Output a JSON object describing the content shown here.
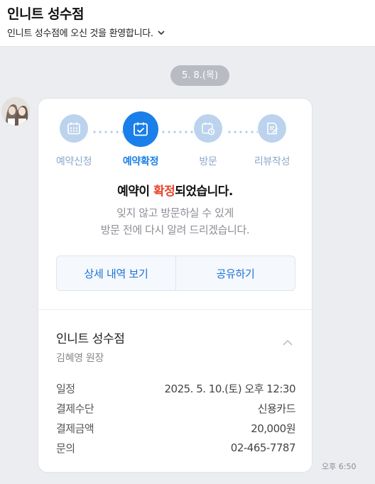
{
  "header": {
    "title": "인니트 성수점",
    "subtitle": "인니트 성수점에 오신 것을 환영합니다."
  },
  "date_pill": "5. 8.(목)",
  "card": {
    "steps": [
      {
        "label": "예약신청",
        "icon": "calendar-grid-icon",
        "active": false
      },
      {
        "label": "예약확정",
        "icon": "calendar-check-icon",
        "active": true
      },
      {
        "label": "방문",
        "icon": "calendar-clock-icon",
        "active": false
      },
      {
        "label": "리뷰작성",
        "icon": "document-edit-icon",
        "active": false
      }
    ],
    "headline": {
      "prefix": "예약이 ",
      "highlight": "확정",
      "suffix": "되었습니다."
    },
    "description": {
      "line1": "잊지 않고 방문하실 수 있게",
      "line2": "방문 전에 다시 알려 드리겠습니다."
    },
    "buttons": {
      "details": "상세 내역 보기",
      "share": "공유하기"
    },
    "shop": {
      "name": "인니트 성수점",
      "staff": "김혜영 원장"
    },
    "info": [
      {
        "key": "일정",
        "value": "2025. 5. 10.(토) 오후 12:30"
      },
      {
        "key": "결제수단",
        "value": "신용카드"
      },
      {
        "key": "결제금액",
        "value": "20,000원"
      },
      {
        "key": "문의",
        "value": "02-465-7787"
      }
    ]
  },
  "timestamp": "오후 6:50",
  "colors": {
    "accent": "#1a7fe8",
    "highlight": "#e8462d",
    "step_inactive": "#bcd3ee",
    "background": "#ecedf1"
  }
}
